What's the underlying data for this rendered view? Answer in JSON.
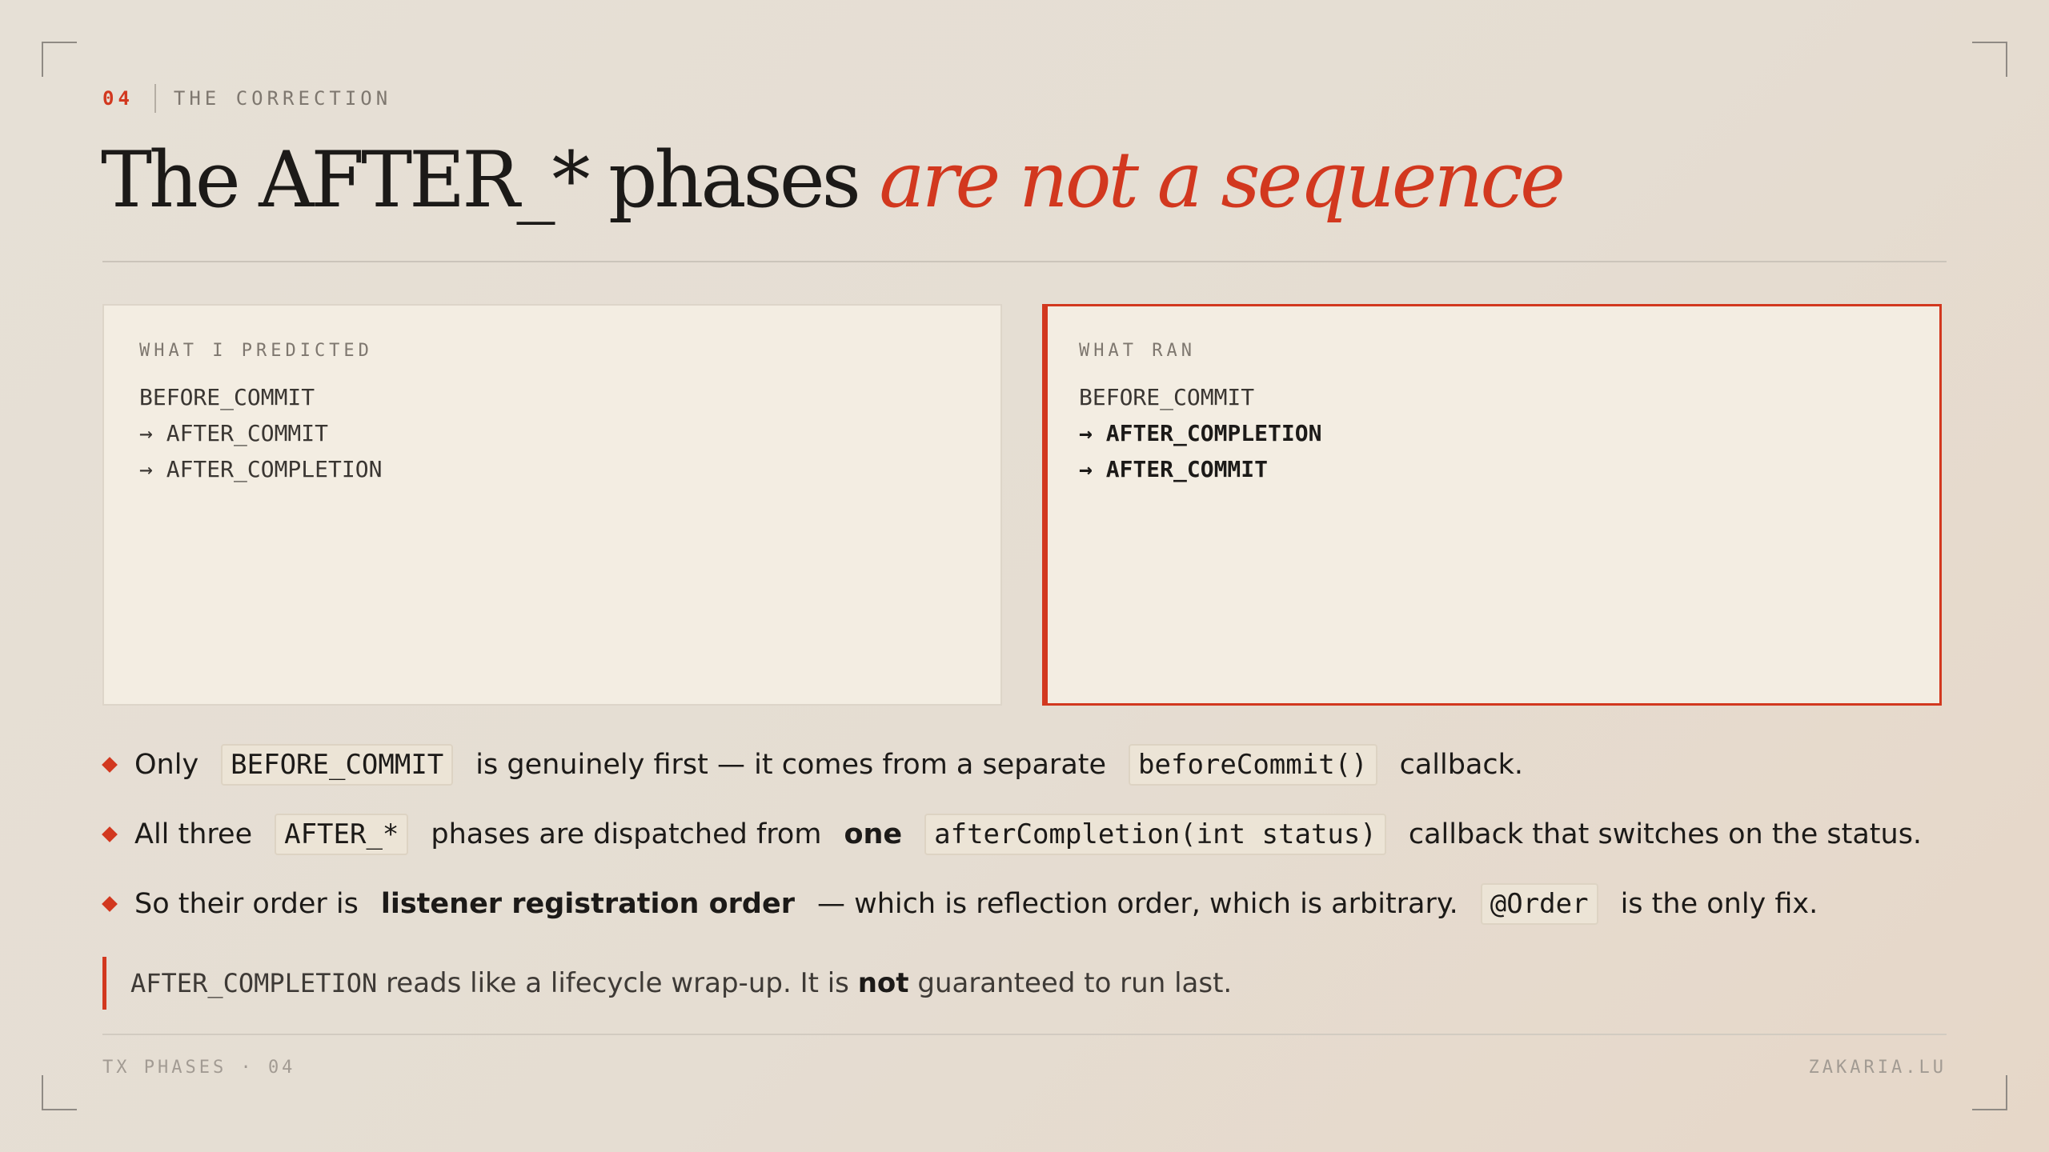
{
  "header": {
    "number": "04",
    "section": "THE CORRECTION"
  },
  "title": {
    "main": "The AFTER_* phases",
    "highlight": "are not a sequence"
  },
  "predicted": {
    "label": "WHAT I PREDICTED",
    "lines": [
      "BEFORE_COMMIT",
      "→ AFTER_COMMIT",
      "→ AFTER_COMPLETION"
    ]
  },
  "actual": {
    "label": "WHAT RAN",
    "lines": [
      "BEFORE_COMMIT",
      "→ AFTER_COMPLETION",
      "→ AFTER_COMMIT"
    ]
  },
  "bullets": [
    {
      "a": "Only",
      "code1": "BEFORE_COMMIT",
      "b": "is genuinely first — it comes from a separate",
      "code2": "beforeCommit()",
      "c": "callback."
    },
    {
      "a": "All three",
      "code1": "AFTER_*",
      "b": "phases are dispatched from",
      "bold": "one",
      "code2": "afterCompletion(int status)",
      "c": "callback that switches on the status."
    },
    {
      "a": "So their order is",
      "bold": "listener registration order",
      "b": "— which is reflection order, which is arbitrary.",
      "code1": "@Order",
      "c": "is the only fix."
    }
  ],
  "note": {
    "code": "AFTER_COMPLETION",
    "a": "reads like a lifecycle wrap-up. It is",
    "bold": "not",
    "b": "guaranteed to run last."
  },
  "footer": {
    "left": "TX PHASES · 04",
    "right": "ZAKARIA.LU"
  },
  "colors": {
    "accent": "#d2381f",
    "background": "#e6e0d6",
    "card": "#f3ede2"
  }
}
